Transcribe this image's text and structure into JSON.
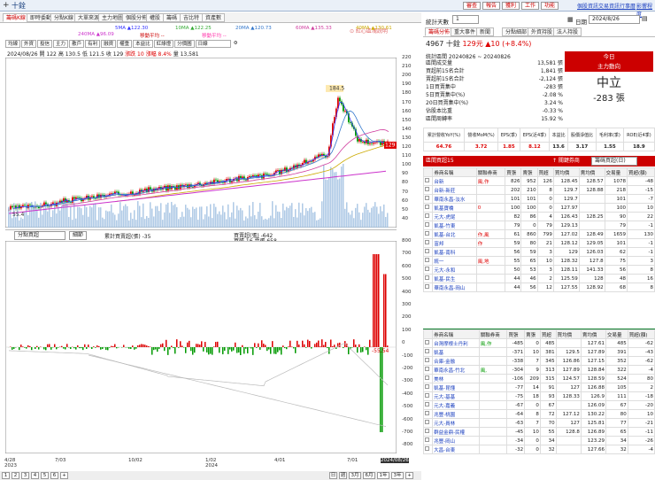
{
  "window": {
    "title": "十銓",
    "plus": "+"
  },
  "top": {
    "buttons": [
      "審查",
      "報告",
      "獲利",
      "工作",
      "功能"
    ],
    "links": [
      "個股資訊",
      "交易資訊",
      "行事曆",
      "影響程度"
    ]
  },
  "tabs": [
    "籌碼K線",
    "即時委動",
    "分點K線",
    "大單來源",
    "主力地圖",
    "個股分佈",
    "權股",
    "籌碼",
    "吉比特",
    "資產數"
  ],
  "note": "⊙ 紅心區塊說明",
  "toolbar2": [
    "均線",
    "外資",
    "投信",
    "主力",
    "散戶",
    "有利",
    "融資",
    "權重",
    "本益比",
    "紅綠燈",
    "分價圖",
    "日線"
  ],
  "info": {
    "date": "2024/08/26",
    "open": "開 122",
    "high": "高 130.5",
    "low": "低 121.5",
    "close": "收 129",
    "chg": "漲跌 10",
    "pct": "漲幅 8.4%",
    "vol": "量 13,581"
  },
  "ma": [
    {
      "t": "5MA ▲122.30",
      "c": "#3333ff"
    },
    {
      "t": "10MA ▲122.25",
      "c": "#33aa33"
    },
    {
      "t": "20MA ▲120.73",
      "c": "#3377cc"
    },
    {
      "t": "60MA ▲135.33",
      "c": "#d040a0"
    },
    {
      "t": "40MA ▲130.61",
      "c": "#ccaa00"
    },
    {
      "t": "240MA ▲96.09",
      "c": "#cc33cc"
    },
    {
      "t": "移動平均 --",
      "c": "#cc0000"
    },
    {
      "t": "移動平均 --",
      "c": "#ff33aa"
    }
  ],
  "main_y": [
    "220",
    "210",
    "200",
    "190",
    "180",
    "170",
    "160",
    "150",
    "140",
    "130",
    "120",
    "110",
    "100",
    "90",
    "80",
    "70",
    "60",
    "50",
    "40"
  ],
  "peak": "184.5",
  "trough": "55.4",
  "price_tag": "129",
  "low_sel": "分點買超",
  "low_btn": "細節",
  "low_legend": {
    "a": "累計買賣超(張) -35",
    "b": "買賣超(張) -642",
    "c": "買張 16 賣張 658"
  },
  "low_y": [
    "800",
    "700",
    "600",
    "500",
    "400",
    "300",
    "200",
    "100",
    "0",
    "-100",
    "-200",
    "-300",
    "-400",
    "-500",
    "-600",
    "-700",
    "-800"
  ],
  "low_tag": "-55.54",
  "x_labels": [
    "4/28",
    "7/03",
    "10/02",
    "1/02",
    "4/01",
    "7/01",
    "2024/08/26"
  ],
  "x_year": [
    "2023",
    "2024"
  ],
  "btabs": [
    "1",
    "2",
    "3",
    "4",
    "5",
    "6",
    "+"
  ],
  "period": [
    "日",
    "週",
    "3月",
    "6月",
    "1年",
    "3年",
    "+"
  ],
  "right": {
    "lbl": "統計天數",
    "days": "1",
    "date_lbl": "日期",
    "date": "2024/8/26",
    "tabs2": [
      "籌碼分佈",
      "重大事件",
      "新聞",
      "分點細部",
      "外資持股",
      "法人持股"
    ],
    "stock": "4967 十銓",
    "price": "129元",
    "chg": "▲10 (+8.4%)",
    "stats_head": "統計區間 20240826 ~ 20240826",
    "stats": [
      [
        "區間成交量",
        "13,581 張"
      ],
      [
        "買超前15名合計",
        "1,841 張"
      ],
      [
        "賣超前15名合計",
        "-2,124 張"
      ],
      [
        "1日買賣集中",
        "-283 張"
      ],
      [
        "5日買賣集中(%)",
        "-2.08 %"
      ],
      [
        "20日買賣集中(%)",
        "3.24 %"
      ],
      [
        "佔股本比重",
        "-0.33 %"
      ],
      [
        "區間周轉率",
        "15.92 %"
      ]
    ],
    "today": "今日",
    "main_dir": "主力動向",
    "main_val": "中立",
    "main_sheets": "-283 張",
    "fin_h": [
      "累計營收YoY(%)",
      "營收MoM(%)",
      "EPS(季)",
      "EPS(近4季)",
      "本益比",
      "股價淨值比",
      "毛利率(季)",
      "ROE(近4季)"
    ],
    "fin_v": [
      "64.76",
      "3.72",
      "1.85",
      "8.12",
      "13.6",
      "3.17",
      "1.55",
      "18.9"
    ],
    "buy_title": "區間買超15",
    "buy_sel": "籌碼買超(日)",
    "cols": [
      "券商名稱",
      "關聯券商",
      "買張",
      "賣張",
      "買超",
      "買均價",
      "賣均價",
      "交易量",
      "買超(額)"
    ],
    "buy": [
      [
        "台新",
        "風,作",
        "826",
        "952",
        "126",
        "128.45",
        "128.57",
        "1078",
        "-48"
      ],
      [
        "台新-新莊",
        "",
        "202",
        "210",
        "8",
        "129.7",
        "128.88",
        "218",
        "-15"
      ],
      [
        "華南永昌-淡水",
        "",
        "101",
        "101",
        "0",
        "129.7",
        "",
        "101",
        "-7"
      ],
      [
        "凱基寶橋",
        "0",
        "100",
        "100",
        "0",
        "127.97",
        "",
        "100",
        "10"
      ],
      [
        "元大-虎尾",
        "",
        "82",
        "86",
        "4",
        "126.43",
        "128.25",
        "90",
        "22"
      ],
      [
        "凱基-竹東",
        "",
        "79",
        "0",
        "79",
        "129.13",
        "",
        "79",
        "-1"
      ],
      [
        "凱基-台北",
        "作,風",
        "61",
        "860",
        "799",
        "127.02",
        "128.49",
        "1659",
        "130"
      ],
      [
        "富邦",
        "作",
        "59",
        "80",
        "21",
        "128.12",
        "129.05",
        "101",
        "-1"
      ],
      [
        "凱基-南科",
        "",
        "56",
        "59",
        "3",
        "129",
        "126.03",
        "62",
        "-1"
      ],
      [
        "統一",
        "風,地",
        "55",
        "65",
        "10",
        "128.32",
        "127.8",
        "75",
        "3"
      ],
      [
        "元大-永和",
        "",
        "50",
        "53",
        "3",
        "128.11",
        "141.33",
        "56",
        "8"
      ],
      [
        "凱基-民生",
        "",
        "44",
        "46",
        "2",
        "125.59",
        "128",
        "48",
        "16"
      ],
      [
        "華南永昌-岡山",
        "",
        "44",
        "56",
        "12",
        "127.55",
        "128.92",
        "68",
        "8"
      ]
    ],
    "sell_title": "區間賣超15",
    "sell_sel": "籌碼賣超(日)",
    "sell": [
      [
        "台灣摩根士丹利",
        "風,作",
        "",
        "-485",
        "0",
        "485",
        "",
        "127.61",
        "485",
        "-62"
      ],
      [
        "凱基",
        "",
        "",
        "-371",
        "10",
        "381",
        "129.5",
        "127.89",
        "391",
        "-43"
      ],
      [
        "合庫-金融",
        "",
        "0",
        "-338",
        "7",
        "345",
        "126.86",
        "127.15",
        "352",
        "-62"
      ],
      [
        "華南永昌-竹北",
        "風,",
        "",
        "-304",
        "9",
        "313",
        "127.89",
        "128.84",
        "322",
        "-4"
      ],
      [
        "美林",
        "",
        "",
        "-106",
        "209",
        "315",
        "124.57",
        "128.59",
        "524",
        "80"
      ],
      [
        "凱基-昆懂",
        "",
        "",
        "-77",
        "14",
        "91",
        "127",
        "126.88",
        "105",
        "2"
      ],
      [
        "元大-基基",
        "",
        "",
        "-75",
        "18",
        "93",
        "128.33",
        "126.9",
        "111",
        "-18"
      ],
      [
        "元大-嘉義",
        "",
        "",
        "-67",
        "0",
        "67",
        "",
        "126.09",
        "67",
        "-20"
      ],
      [
        "兆豐-桃園",
        "",
        "",
        "-64",
        "8",
        "72",
        "127.12",
        "130.22",
        "80",
        "10"
      ],
      [
        "元大-員林",
        "",
        "",
        "-63",
        "7",
        "70",
        "127",
        "125.81",
        "77",
        "-21"
      ],
      [
        "群益金鼎-民權",
        "",
        "",
        "-45",
        "10",
        "55",
        "128.8",
        "126.89",
        "65",
        "-11"
      ],
      [
        "兆豐-岡山",
        "",
        "",
        "-34",
        "0",
        "34",
        "",
        "123.29",
        "34",
        "-26"
      ],
      [
        "大昌-台東",
        "",
        "",
        "-32",
        "0",
        "32",
        "",
        "127.66",
        "32",
        "-4"
      ]
    ]
  }
}
